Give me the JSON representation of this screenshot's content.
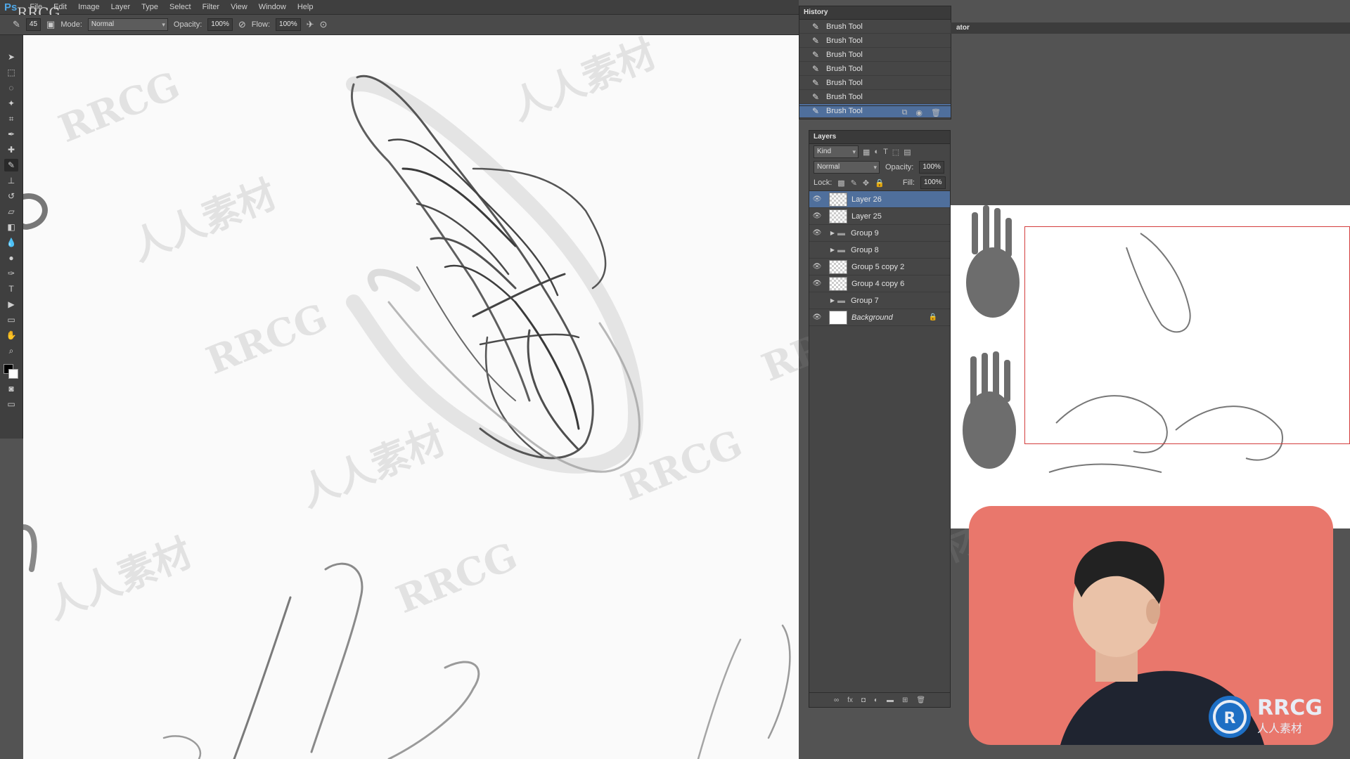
{
  "app": {
    "logo": "Ps"
  },
  "menubar": {
    "items": [
      "File",
      "Edit",
      "Image",
      "Layer",
      "Type",
      "Select",
      "Filter",
      "View",
      "Window",
      "Help"
    ]
  },
  "options": {
    "brush_size": "45",
    "mode_label": "Mode:",
    "mode_value": "Normal",
    "opacity_label": "Opacity:",
    "opacity_value": "100%",
    "flow_label": "Flow:",
    "flow_value": "100%"
  },
  "toolbar": {
    "tools": [
      "move-tool",
      "marquee-tool",
      "lasso-tool",
      "magic-wand-tool",
      "crop-tool",
      "eyedropper-tool",
      "healing-brush-tool",
      "brush-tool",
      "clone-stamp-tool",
      "history-brush-tool",
      "eraser-tool",
      "gradient-tool",
      "blur-tool",
      "dodge-tool",
      "pen-tool",
      "type-tool",
      "path-selection-tool",
      "rectangle-tool",
      "hand-tool",
      "zoom-tool"
    ]
  },
  "history": {
    "title": "History",
    "items": [
      "Brush Tool",
      "Brush Tool",
      "Brush Tool",
      "Brush Tool",
      "Brush Tool",
      "Brush Tool",
      "Brush Tool"
    ],
    "selected_index": 6
  },
  "navigator": {
    "title": "ator"
  },
  "layers": {
    "title": "Layers",
    "filter": "Kind",
    "blend_mode": "Normal",
    "opacity_label": "Opacity:",
    "opacity_value": "100%",
    "lock_label": "Lock:",
    "fill_label": "Fill:",
    "fill_value": "100%",
    "items": [
      {
        "name": "Layer 26",
        "type": "layer",
        "selected": true
      },
      {
        "name": "Layer 25",
        "type": "layer"
      },
      {
        "name": "Group 9",
        "type": "group"
      },
      {
        "name": "Group 8",
        "type": "group"
      },
      {
        "name": "Group 5 copy 2",
        "type": "layer"
      },
      {
        "name": "Group 4 copy 6",
        "type": "layer"
      },
      {
        "name": "Group 7",
        "type": "group"
      },
      {
        "name": "Background",
        "type": "background",
        "locked": true
      }
    ]
  },
  "watermark": {
    "text_latin": "RRCG",
    "text_cn": "人人素材"
  },
  "brand": {
    "name": "RRCG",
    "sub": "人人素材"
  },
  "colors": {
    "accent": "#4f6f9c",
    "webcam_bg": "#e9776c",
    "nav_box": "#d43c3c"
  }
}
